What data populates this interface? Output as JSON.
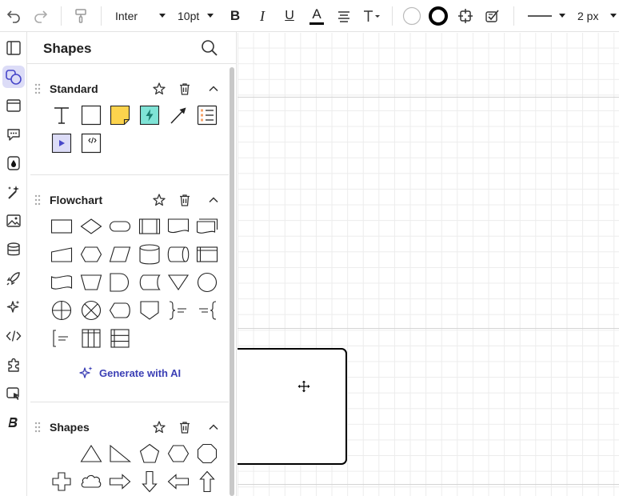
{
  "toolbar": {
    "font_family": "Inter",
    "font_size": "10pt",
    "bold_label": "B",
    "italic_label": "I",
    "underline_label": "U",
    "text_color_label": "A",
    "line_width": "2 px",
    "icons": [
      "undo-icon",
      "redo-icon",
      "format-painter-icon",
      "align-icon",
      "text-options-icon",
      "fill-color-icon",
      "border-color-icon",
      "arrange-icon",
      "format-checklist-icon",
      "line-style-icon"
    ]
  },
  "rail": {
    "items": [
      "layout-icon",
      "shapes-icon",
      "frame-icon",
      "comments-icon",
      "color-drop-icon",
      "magic-wand-icon",
      "image-icon",
      "data-icon",
      "rocket-icon",
      "sparkle-icon",
      "code-icon",
      "puzzle-icon",
      "presentation-icon",
      "brand-icon"
    ],
    "active": "shapes-icon"
  },
  "panel": {
    "title": "Shapes",
    "sections": [
      {
        "title": "Standard"
      },
      {
        "title": "Flowchart"
      },
      {
        "title": "Shapes"
      }
    ],
    "generate_ai_label": "Generate with AI"
  },
  "colors": {
    "accent": "#3b3fb5",
    "active_rail_bg": "#dcdcf7",
    "sticky_yellow": "#fcd34d",
    "action_teal": "#7fe3d6",
    "grid_line": "#ececec",
    "page_line": "#d4d4d4"
  }
}
